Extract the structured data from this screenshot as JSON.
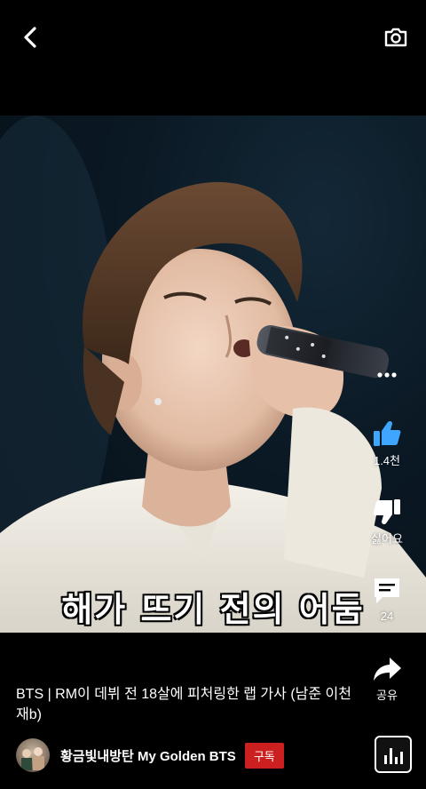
{
  "video": {
    "caption": "해가 뜨기 전의 어둠"
  },
  "actions": {
    "like_count": "1.4천",
    "dislike_label": "싫어요",
    "comment_count": "24",
    "share_label": "공유"
  },
  "video_title": "BTS | RM이 데뷔 전 18살에 피처링한 랩 가사 (남준 이천재b)",
  "channel": {
    "name": "황금빛내방탄 My Golden BTS",
    "subscribe_label": "구독"
  },
  "icons": {
    "back": "back-arrow-icon",
    "camera": "camera-icon",
    "more": "more-dots-icon",
    "like": "thumbs-up-icon",
    "dislike": "thumbs-down-icon",
    "comment": "comment-icon",
    "share": "share-arrow-icon",
    "sound": "sound-equalizer-icon"
  },
  "colors": {
    "background": "#000000",
    "like_accent": "#3ea6ff",
    "subscribe": "#cc1f1f"
  }
}
